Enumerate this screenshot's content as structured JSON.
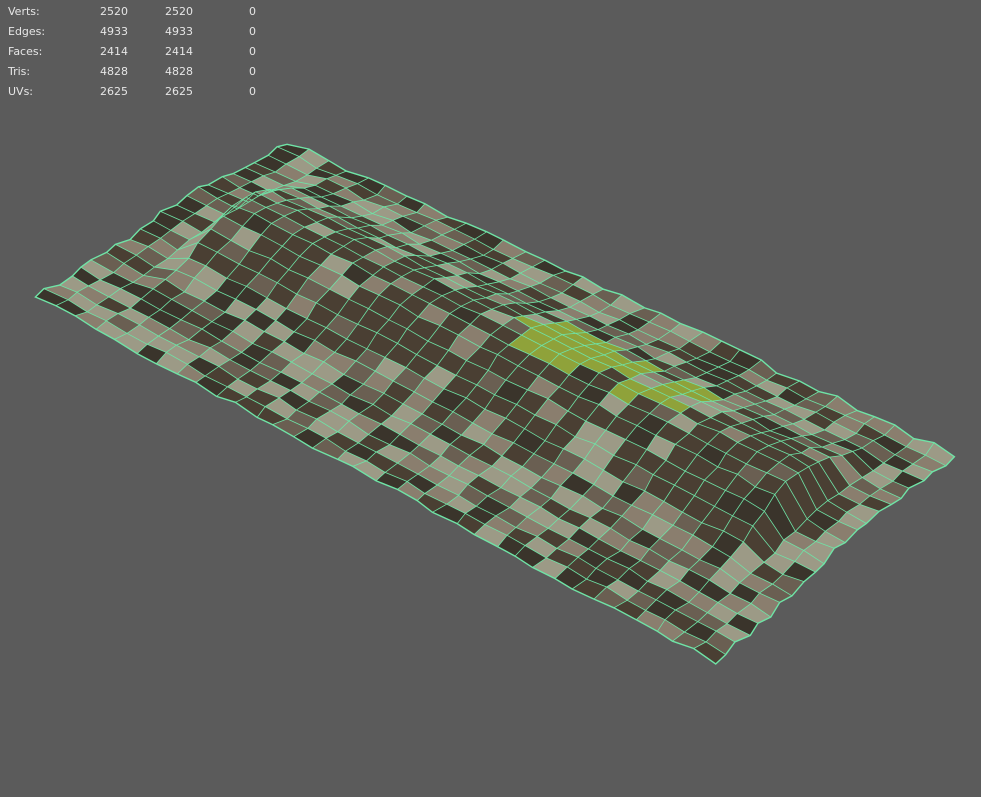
{
  "hud": {
    "rows": [
      {
        "label": "Verts:",
        "v1": "2520",
        "v2": "2520",
        "v3": "0"
      },
      {
        "label": "Edges:",
        "v1": "4933",
        "v2": "4933",
        "v3": "0"
      },
      {
        "label": "Faces:",
        "v1": "2414",
        "v2": "2414",
        "v3": "0"
      },
      {
        "label": "Tris:",
        "v1": "4828",
        "v2": "4828",
        "v3": "0"
      },
      {
        "label": "UVs:",
        "v1": "2625",
        "v2": "2625",
        "v3": "0"
      }
    ]
  },
  "viewport": {
    "background_color": "#5b5b5b",
    "wireframe_color": "#6fe3a6",
    "texture_colors": [
      "#6a5f52",
      "#4a3f33",
      "#8a7e6e",
      "#3a342b",
      "#9c9a86"
    ],
    "moss_color": "#8fa23a",
    "object": "textured terrain mesh with log (wireframe on shaded)"
  }
}
